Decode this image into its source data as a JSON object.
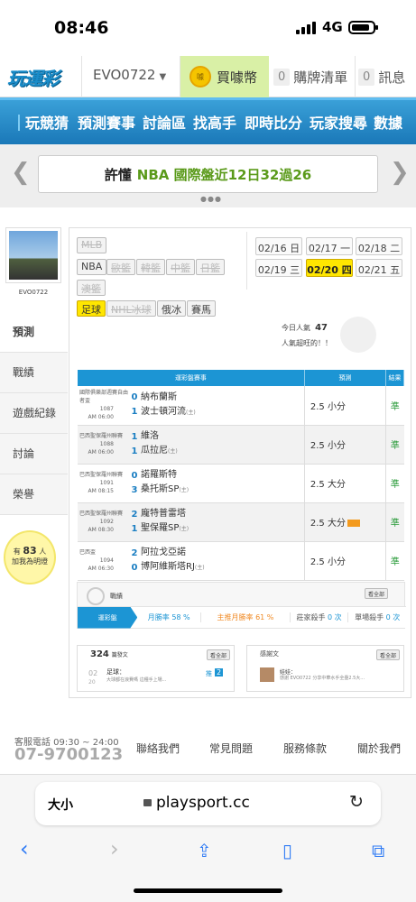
{
  "status": {
    "time": "08:46",
    "network": "4G"
  },
  "header": {
    "logo": "玩運彩",
    "username": "EVO0722",
    "buy_coin": "買噱幣",
    "coin_icon": "噱",
    "cart_count": "0",
    "cart_label": "購牌清單",
    "msg_count": "0",
    "msg_label": "訊息"
  },
  "menu": [
    "玩競猜",
    "預測賽事",
    "討論區",
    "找高手",
    "即時比分",
    "玩家搜尋",
    "數據"
  ],
  "banner": {
    "prefix": "許懂",
    "text": "NBA 國際盤近12日32過26"
  },
  "profile": {
    "name": "EVO0722"
  },
  "side_tabs": [
    "預測",
    "戰績",
    "遊戲紀錄",
    "討論",
    "榮譽"
  ],
  "fans": {
    "prefix": "有",
    "count": "83",
    "suffix": "人",
    "line2": "加我為明燈"
  },
  "sports_row1": [
    "MLB"
  ],
  "sports_row2": [
    "NBA",
    "歐籃",
    "韓籃",
    "中籃",
    "日籃",
    "澳籃"
  ],
  "sports_row3": [
    "足球",
    "NHL冰球",
    "俄冰",
    "賽馬"
  ],
  "dates": [
    "02/16 日",
    "02/17 一",
    "02/18 二",
    "02/19 三",
    "02/20 四",
    "02/21 五"
  ],
  "popularity": {
    "label": "今日人氣",
    "value": "47",
    "note": "人氣超旺的！！"
  },
  "table": {
    "headers": [
      "運彩盤賽事",
      "預測",
      "結果"
    ],
    "rows": [
      {
        "league": "國際俱樂部週賽自由者盃",
        "num": "1087",
        "time": "AM 06:00",
        "s1": "0",
        "t1": "納布蘭斯",
        "s2": "1",
        "t2": "波士頓河流",
        "t2_tag": "(主)",
        "pred": "2.5 小分",
        "hot": false,
        "result": "準"
      },
      {
        "league": "巴西聖保羅州聯賽",
        "num": "1088",
        "time": "AM 06:00",
        "s1": "1",
        "t1": "維洛",
        "s2": "1",
        "t2": "瓜拉尼",
        "t2_tag": "(主)",
        "pred": "2.5 小分",
        "hot": false,
        "result": "準"
      },
      {
        "league": "巴西聖保羅州聯賽",
        "num": "1091",
        "time": "AM 08:15",
        "s1": "0",
        "t1": "諾羅斯特",
        "s2": "3",
        "t2": "桑托斯SP",
        "t2_tag": "(主)",
        "pred": "2.5 大分",
        "hot": false,
        "result": "準"
      },
      {
        "league": "巴西聖保羅州聯賽",
        "num": "1092",
        "time": "AM 08:30",
        "s1": "2",
        "t1": "龐特普雷塔",
        "s2": "1",
        "t2": "聖保羅SP",
        "t2_tag": "(主)",
        "pred": "2.5 大分",
        "hot": true,
        "result": "準"
      },
      {
        "league": "巴西盃",
        "num": "1094",
        "time": "AM 06:30",
        "s1": "2",
        "t1": "阿拉戈亞諾",
        "s2": "0",
        "t2": "博阿維斯塔RJ",
        "t2_tag": "(主)",
        "pred": "2.5 小分",
        "hot": false,
        "result": "準"
      }
    ]
  },
  "stats": {
    "title": "戰績",
    "see_all": "看全部",
    "tab": "運彩盤",
    "items": [
      {
        "label": "月勝率",
        "value": "58 %"
      },
      {
        "label": "主推月勝率",
        "value": "61 %"
      },
      {
        "label": "莊家殺手",
        "value": "0 次"
      },
      {
        "label": "單場殺手",
        "value": "0 次"
      }
    ]
  },
  "posts": {
    "count": "324",
    "label": "篇發文",
    "see_all": "看全部",
    "date_m": "02",
    "date_d": "20",
    "title": "足球：",
    "snippet": "大球都在浪費嗎 這種手上場...",
    "push": "推",
    "push_count": "2"
  },
  "thanks": {
    "label": "感謝文",
    "see_all": "看全部",
    "user": "娃娃：",
    "text": "感謝 EVO0722 分享中華水手全壘2.5大..."
  },
  "footer": {
    "service": "客服電話 09:30 ~ 24:00",
    "phone": "07-9700123",
    "links": [
      "聯絡我們",
      "常見問題",
      "服務條款",
      "關於我們"
    ]
  },
  "browser": {
    "aa": "大小",
    "url": "playsport.cc"
  }
}
